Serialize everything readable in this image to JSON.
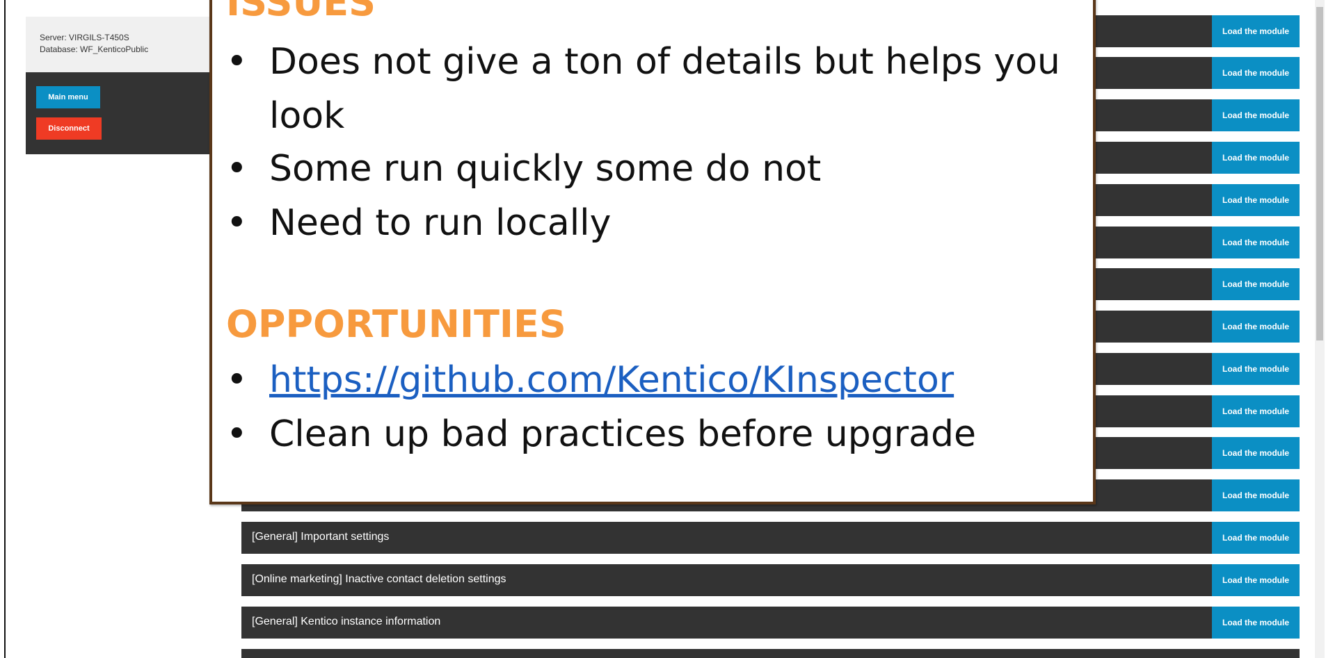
{
  "connection": {
    "server": "Server: VIRGILS-T450S",
    "database": "Database: WF_KenticoPublic"
  },
  "menu": {
    "main_menu": "Main menu",
    "disconnect": "Disconnect"
  },
  "modules": {
    "load_label": "Load the module",
    "items": [
      {
        "name": ""
      },
      {
        "name": ""
      },
      {
        "name": ""
      },
      {
        "name": ""
      },
      {
        "name": ""
      },
      {
        "name": ""
      },
      {
        "name": ""
      },
      {
        "name": ""
      },
      {
        "name": ""
      },
      {
        "name": ""
      },
      {
        "name": ""
      },
      {
        "name": ""
      },
      {
        "name": "[General] Important settings"
      },
      {
        "name": "[Online marketing] Inactive contact deletion settings"
      },
      {
        "name": "[General] Kentico instance information"
      },
      {
        "name": ""
      }
    ]
  },
  "slide": {
    "issues_title": "ISSUES",
    "issues": [
      "Does not give a ton of details but helps you look",
      "Some run quickly some do not",
      "Need to run locally"
    ],
    "opportunities_title": "OPPORTUNITIES",
    "opportunities": [
      {
        "text": "https://github.com/Kentico/KInspector",
        "link": true
      },
      {
        "text": "Clean up bad practices before upgrade",
        "link": false
      }
    ],
    "bullet_char": "•",
    "colors": {
      "title": "#f79a3e",
      "link": "#1b5fc1",
      "border": "#5a3719"
    }
  },
  "colors": {
    "row_bg": "#333333",
    "load_button": "#0b8fc4",
    "disconnect_button": "#ef3b24"
  }
}
